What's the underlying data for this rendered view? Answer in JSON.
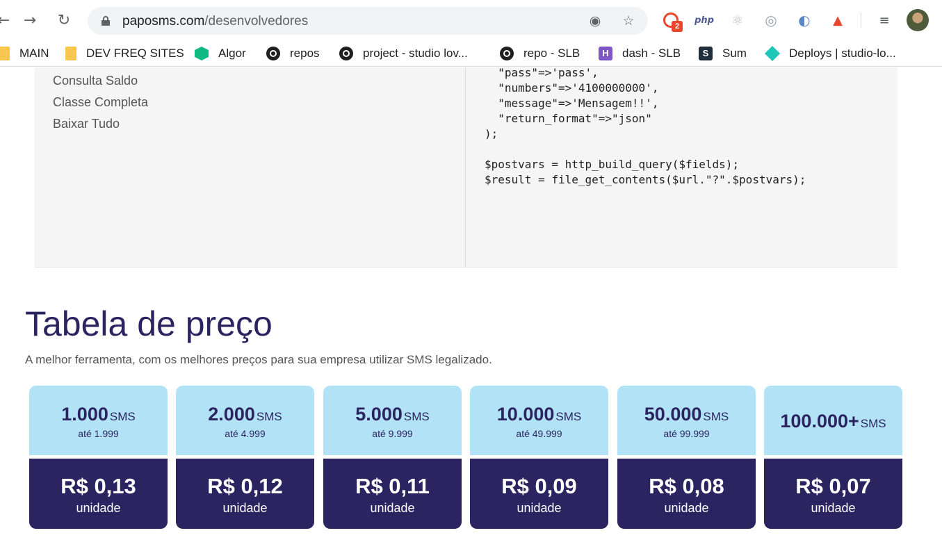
{
  "browser": {
    "url_host": "paposms.com",
    "url_path": "/desenvolvedores",
    "extensions": [
      {
        "name": "extension-1-icon",
        "badge": "2"
      },
      {
        "name": "php-extension-icon",
        "label": "php"
      }
    ]
  },
  "bookmarks": [
    {
      "label": "MAIN",
      "icon": "folder-icon"
    },
    {
      "label": "DEV FREQ SITES",
      "icon": "folder-icon"
    },
    {
      "label": "Algor",
      "icon": "algor-icon"
    },
    {
      "label": "repos",
      "icon": "github-icon"
    },
    {
      "label": "project - studio lov...",
      "icon": "github-icon"
    },
    {
      "label": "repo - SLB",
      "icon": "github-icon"
    },
    {
      "label": "dash - SLB",
      "icon": "heroku-icon"
    },
    {
      "label": "Sum",
      "icon": "sumo-icon"
    },
    {
      "label": "Deploys | studio-lo...",
      "icon": "netlify-icon"
    }
  ],
  "docs": {
    "side_links": [
      "Consulta Saldo",
      "Classe Completa",
      "Baixar Tudo"
    ],
    "code_lines": [
      "  \"pass\"=>'pass',",
      "  \"numbers\"=>'4100000000',",
      "  \"message\"=>'Mensagem!!',",
      "  \"return_format\"=>\"json\"",
      ");",
      "",
      "$postvars = http_build_query($fields);",
      "$result = file_get_contents($url.\"?\".$postvars);"
    ]
  },
  "pricing": {
    "title": "Tabela de preço",
    "subtitle": "A melhor ferramenta, com os melhores preços para sua empresa utilizar SMS legalizado.",
    "unit_label": "SMS",
    "per_label": "unidade",
    "plans": [
      {
        "qty": "1.000",
        "range": "até 1.999",
        "price": "R$ 0,13"
      },
      {
        "qty": "2.000",
        "range": "até 4.999",
        "price": "R$ 0,12"
      },
      {
        "qty": "5.000",
        "range": "até 9.999",
        "price": "R$ 0,11"
      },
      {
        "qty": "10.000",
        "range": "até 49.999",
        "price": "R$ 0,09"
      },
      {
        "qty": "50.000",
        "range": "até 99.999",
        "price": "R$ 0,08"
      },
      {
        "qty": "100.000+",
        "range": "",
        "price": "R$ 0,07"
      }
    ]
  },
  "colors": {
    "accent_dark": "#2c2461",
    "accent_light": "#b1e2f5"
  }
}
